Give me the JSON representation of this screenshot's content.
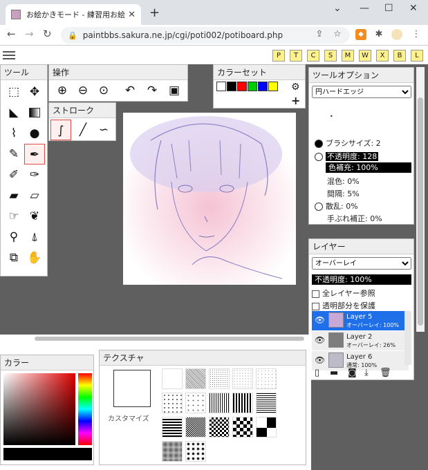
{
  "browser": {
    "tab_title": "お絵かきモード - 練習用お絵かき掲示",
    "url": "paintbbs.sakura.ne.jp/cgi/poti002/potiboard.php"
  },
  "topbar": {
    "buttons": [
      "P",
      "T",
      "C",
      "S",
      "M",
      "W",
      "X",
      "B",
      "L"
    ]
  },
  "tools": {
    "title": "ツール"
  },
  "operations": {
    "title": "操作"
  },
  "stroke": {
    "title": "ストローク"
  },
  "colorset": {
    "title": "カラーセット",
    "swatches": [
      "#ffffff",
      "#000000",
      "#ff0000",
      "#00cc00",
      "#0000ff",
      "#ffff00"
    ]
  },
  "tool_options": {
    "title": "ツールオプション",
    "brush_type": "円ハードエッジ",
    "brush_size": "ブラシサイズ: 2",
    "opacity": "不透明度: 128",
    "color_fill": "色補充: 100%",
    "mix": "混色: 0%",
    "interval": "間隔: 5%",
    "scatter": "散乱: 0%",
    "stabilizer": "手ぶれ補正: 0%"
  },
  "layers": {
    "title": "レイヤー",
    "blend_mode": "オーバーレイ",
    "opacity": "不透明度: 100%",
    "ref_all": "全レイヤー参照",
    "protect_alpha": "透明部分を保護",
    "items": [
      {
        "name": "Layer 5",
        "mode": "オーバーレイ: 100%"
      },
      {
        "name": "Layer 2",
        "mode": "オーバーレイ: 26%"
      },
      {
        "name": "Layer 6",
        "mode": "通常: 100%"
      }
    ]
  },
  "color": {
    "title": "カラー"
  },
  "texture": {
    "title": "テクスチャ",
    "custom": "カスタマイズ"
  }
}
